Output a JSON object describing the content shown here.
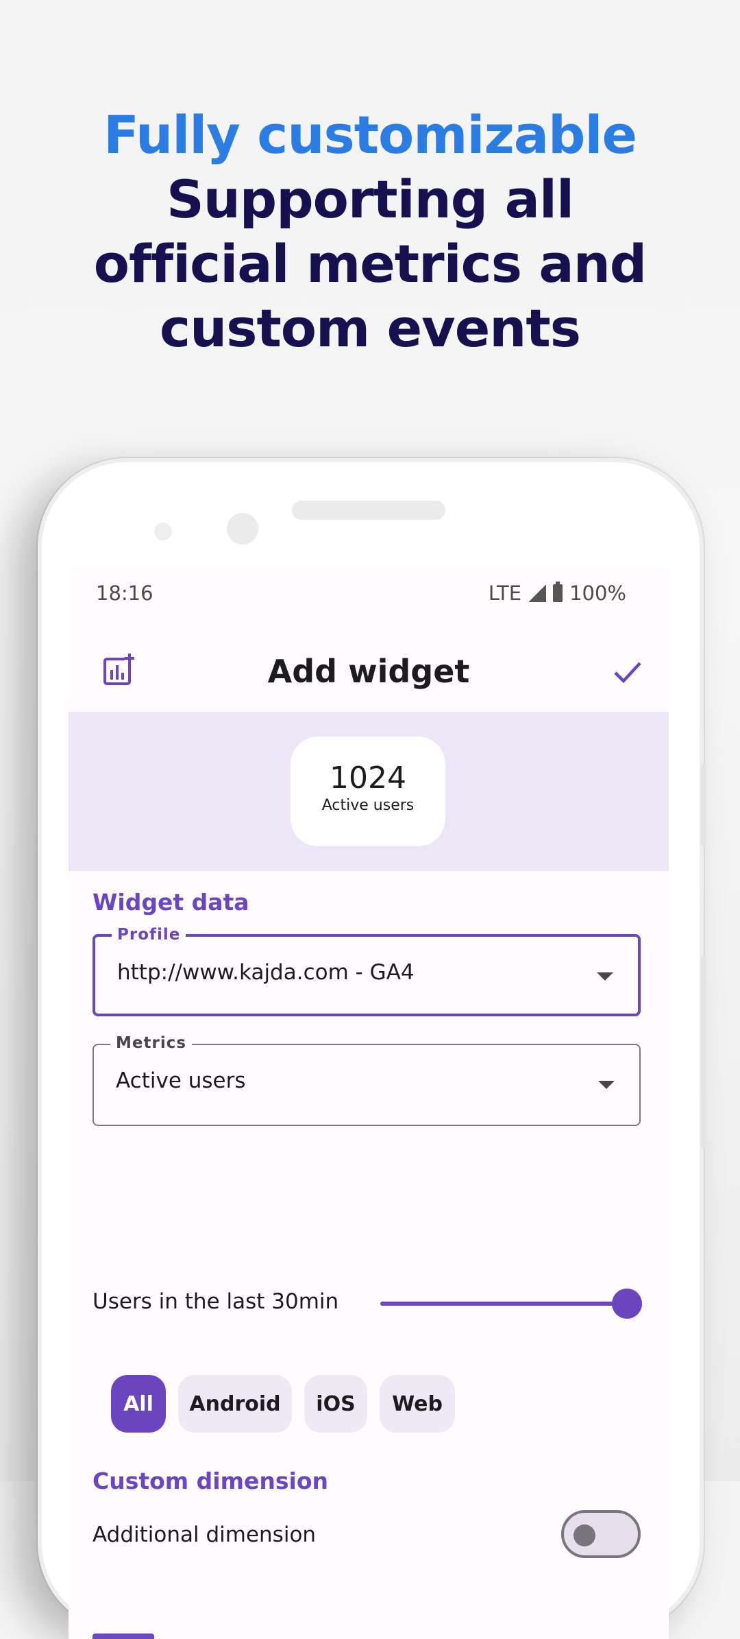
{
  "headline": {
    "accent_line": "Fully customizable",
    "lines": [
      "Supporting all",
      "official metrics and",
      "custom events"
    ]
  },
  "status_bar": {
    "time": "18:16",
    "network": "LTE",
    "battery": "100%"
  },
  "app_bar": {
    "title": "Add widget",
    "left_icon": "add-chart-icon",
    "right_icon": "check-icon"
  },
  "preview_widget": {
    "value": "1024",
    "label": "Active users"
  },
  "widget_data": {
    "section_title": "Widget data",
    "profile_field": {
      "label": "Profile",
      "value": "http://www.kajda.com - GA4"
    },
    "metrics_field": {
      "label": "Metrics",
      "value": "Active users"
    },
    "slider": {
      "label": "Users in the last 30min",
      "fraction": 1.0
    },
    "platform_chips": [
      {
        "label": "All",
        "selected": true
      },
      {
        "label": "Android",
        "selected": false
      },
      {
        "label": "iOS",
        "selected": false
      },
      {
        "label": "Web",
        "selected": false
      }
    ]
  },
  "custom_dimension": {
    "section_title": "Custom dimension",
    "toggle_label": "Additional dimension",
    "toggle_on": false
  },
  "colors": {
    "accent_blue": "#2b7de3",
    "headline_dark": "#16104f",
    "primary_purple": "#6a45bf",
    "preview_bg": "#ede6f7"
  }
}
